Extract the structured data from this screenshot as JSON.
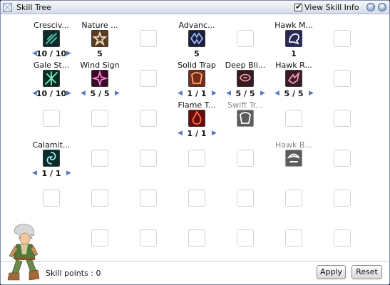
{
  "window": {
    "title": "Skill Tree"
  },
  "header": {
    "view_skill_info_label": "View Skill Info",
    "view_skill_info_checked": true
  },
  "skills": [
    {
      "id": "crescive",
      "name": "Cresciv...",
      "level": "10 / 10",
      "has_arrows": true,
      "icon": "crescive-bolt-icon",
      "locked": false
    },
    {
      "id": "nature",
      "name": "Nature ...",
      "level": "5",
      "has_arrows": false,
      "icon": "nature-friendly-icon",
      "locked": false
    },
    {
      "id": "advanced",
      "name": "Advanc...",
      "level": "5",
      "has_arrows": false,
      "icon": "advanced-trap-icon",
      "locked": false
    },
    {
      "id": "hawk-m",
      "name": "Hawk M...",
      "level": "1",
      "has_arrows": false,
      "icon": "hawk-mastery-icon",
      "locked": false
    },
    {
      "id": "gale",
      "name": "Gale St...",
      "level": "10 / 10",
      "has_arrows": true,
      "icon": "gale-storm-icon",
      "locked": false
    },
    {
      "id": "wind",
      "name": "Wind Sign",
      "level": "5 / 5",
      "has_arrows": true,
      "icon": "wind-sign-icon",
      "locked": false
    },
    {
      "id": "solid",
      "name": "Solid Trap",
      "level": "1 / 1",
      "has_arrows": true,
      "icon": "solid-trap-icon",
      "locked": false
    },
    {
      "id": "deep",
      "name": "Deep Bli...",
      "level": "5 / 5",
      "has_arrows": true,
      "icon": "deep-blind-trap-icon",
      "locked": false
    },
    {
      "id": "hawk-r",
      "name": "Hawk R...",
      "level": "5 / 5",
      "has_arrows": true,
      "icon": "hawk-rush-icon",
      "locked": false
    },
    {
      "id": "flame",
      "name": "Flame T...",
      "level": "1 / 1",
      "has_arrows": true,
      "icon": "flame-trap-icon",
      "locked": false
    },
    {
      "id": "swift",
      "name": "Swift Tr...",
      "level": "",
      "has_arrows": false,
      "icon": "swift-trap-icon",
      "locked": true
    },
    {
      "id": "calamity",
      "name": "Calamit...",
      "level": "1 / 1",
      "has_arrows": true,
      "icon": "calamity-gale-icon",
      "locked": false
    },
    {
      "id": "hawk-b",
      "name": "Hawk B...",
      "level": "",
      "has_arrows": false,
      "icon": "hawk-boomerang-icon",
      "locked": true
    }
  ],
  "footer": {
    "skill_points": "Skill points : 0",
    "apply_label": "Apply",
    "reset_label": "Reset"
  },
  "icons": {
    "minimize": "minimize-icon",
    "close": "close-icon",
    "checkbox_tick": "✔",
    "arrow_left": "◀",
    "arrow_right": "▶",
    "minimize_glyph": "−",
    "close_glyph": "×"
  },
  "colors": {
    "arrow": "#5a78b8",
    "title_bar": "#d4dce9",
    "window_border": "#7a8ca8"
  }
}
